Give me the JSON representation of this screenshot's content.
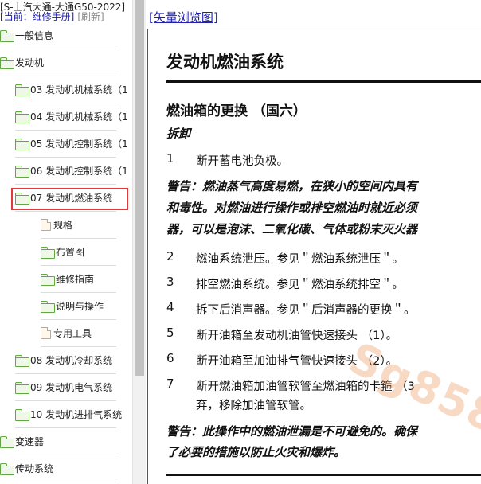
{
  "nav": {
    "title": "[S-上汽大通-大通G50-2022]",
    "current_label": "[当前：维修手册]",
    "refresh_label": "[刷新]",
    "items": [
      {
        "label": "一般信息",
        "icon": "folder-icon"
      },
      {
        "label": "发动机",
        "icon": "folder-icon"
      },
      {
        "label": "03 发动机机械系统（1",
        "icon": "folder-icon"
      },
      {
        "label": "04 发动机机械系统（1",
        "icon": "folder-icon"
      },
      {
        "label": "05 发动机控制系统（1",
        "icon": "folder-icon"
      },
      {
        "label": "06 发动机控制系统（1",
        "icon": "folder-icon"
      },
      {
        "label": "07 发动机燃油系统",
        "icon": "folder-icon",
        "selected": true
      },
      {
        "label": "规格",
        "icon": "document-icon"
      },
      {
        "label": "布置图",
        "icon": "folder-icon"
      },
      {
        "label": "维修指南",
        "icon": "folder-icon"
      },
      {
        "label": "说明与操作",
        "icon": "folder-icon"
      },
      {
        "label": "专用工具",
        "icon": "document-icon"
      },
      {
        "label": "08 发动机冷却系统",
        "icon": "folder-icon"
      },
      {
        "label": "09 发动机电气系统",
        "icon": "folder-icon"
      },
      {
        "label": "10 发动机进排气系统",
        "icon": "folder-icon"
      },
      {
        "label": "变速器",
        "icon": "folder-icon"
      },
      {
        "label": "传动系统",
        "icon": "folder-icon"
      }
    ],
    "selected_color": "#e03a3a"
  },
  "doc": {
    "vector_link": "[矢量浏览图]",
    "title": "发动机燃油系统",
    "section_title": "燃油箱的更换 （国六）",
    "sub_heading": "拆卸",
    "steps": [
      {
        "num": "1",
        "text": "断开蓄电池负极。"
      },
      {
        "num": "2",
        "text": "燃油系统泄压。参见＂燃油系统泄压＂。"
      },
      {
        "num": "3",
        "text": "排空燃油系统。参见＂燃油系统排空＂。"
      },
      {
        "num": "4",
        "text": "拆下后消声器。参见＂后消声器的更换＂。"
      },
      {
        "num": "5",
        "text": "断开油箱至发动机油管快速接头 （1）。"
      },
      {
        "num": "6",
        "text": "断开油箱至加油排气管快速接头 （2）。"
      },
      {
        "num": "7",
        "text": "断开燃油箱加油管软管至燃油箱的卡箍 （3",
        "text2": "弃，移除加油管软管。"
      }
    ],
    "warning1": [
      "警告：燃油蒸气高度易燃，在狭小的空间内具有",
      "和毒性。对燃油进行操作或排空燃油时就近必须",
      "器，可以是泡沫、二氧化碳、气体或粉末灭火器"
    ],
    "warning2": [
      "警告：此操作中的燃油泄漏是不可避免的。确保",
      "了必要的措施以防止火灾和爆炸。"
    ]
  },
  "watermark": "Sg858"
}
